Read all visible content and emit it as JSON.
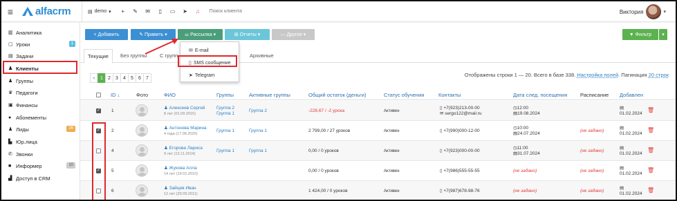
{
  "colors": {
    "accent": "#2d8ed6",
    "green": "#5bb24f",
    "red": "#e0262b",
    "teal": "#4a9e7a"
  },
  "topbar": {
    "logo": "alfacrm",
    "branch": "demo",
    "icons": [
      "plus-icon",
      "edit-icon",
      "mail-icon",
      "phone-icon",
      "sms-icon",
      "telegram-icon",
      "bell-icon"
    ],
    "search_placeholder": "Поиск клиента",
    "user_name": "Виктория"
  },
  "sidebar": {
    "items": [
      {
        "label": "Аналитика",
        "icon": "chart-icon"
      },
      {
        "label": "Уроки",
        "icon": "calendar-icon",
        "badge": "1"
      },
      {
        "label": "Задачи",
        "icon": "tasks-icon"
      },
      {
        "label": "Клиенты",
        "icon": "user-icon"
      },
      {
        "label": "Группы",
        "icon": "group-icon"
      },
      {
        "label": "Педагоги",
        "icon": "teacher-icon"
      },
      {
        "label": "Финансы",
        "icon": "money-icon"
      },
      {
        "label": "Абонементы",
        "icon": "ticket-icon"
      },
      {
        "label": "Лиды",
        "icon": "lead-icon",
        "badge": "26"
      },
      {
        "label": "Юр.лица",
        "icon": "building-icon"
      },
      {
        "label": "Звонки",
        "icon": "phone-icon"
      },
      {
        "label": "Информер",
        "icon": "informer-icon",
        "badge": "10"
      },
      {
        "label": "Доступ в CRM",
        "icon": "lock-icon"
      }
    ]
  },
  "toolbar": {
    "add": "+ Добавить",
    "edit": "✎ Править ▾",
    "mailing": "⚌ Рассылка ▾",
    "reports": "⊞ Отчеты ▾",
    "other": "— Другое ▾",
    "filter": "▼ Фильтр"
  },
  "mailing_menu": {
    "items": [
      "E-mail",
      "SMS сообщение",
      "Telegram"
    ]
  },
  "tabs": [
    "Текущие",
    "Без группы",
    "С групп",
    "Архивные"
  ],
  "pager": {
    "pages": [
      "«",
      "1",
      "2",
      "3",
      "4",
      "5",
      "6",
      "7"
    ],
    "active": "1"
  },
  "summary": {
    "text": "Отображены строки 1 — 20. Всего в базе 338.",
    "settings_link": "Настройка полей",
    "pagination_label": ". Пагинация",
    "per_page": "20 строк"
  },
  "table": {
    "headers": [
      "ID ↓",
      "Фото",
      "ФИО",
      "Группы",
      "Активные группы",
      "Общий остаток (деньги)",
      "Статус обучения",
      "Контакты",
      "Дата след. посещения",
      "Расписание",
      "Добавлен"
    ],
    "rows": [
      {
        "checked": true,
        "id": "1",
        "name": "Алексеев Сергей",
        "age": "8 лет (01.09.2015)",
        "groups": [
          "Группа 2",
          "Группа 1"
        ],
        "active": "Группа 2",
        "balance": "-228,67 / -2 урока",
        "balance_negative": true,
        "status": "Активен",
        "phone": "+7(923)213-00-00",
        "email": "sergo122@mail.ru",
        "next_time": "12:00",
        "next_date": "19.08.2024",
        "schedule": "",
        "added": "01.02.2024"
      },
      {
        "checked": true,
        "id": "2",
        "name": "Антонова Марина",
        "age": "4 года (17.08.2020)",
        "groups": [
          "Группа 1"
        ],
        "active": "Группа 1",
        "balance": "2 799,00 / 27 уроков",
        "balance_negative": false,
        "status": "Активен",
        "phone": "+7(990)000-12-00",
        "email": "",
        "next_time": "10:00",
        "next_date": "24.07.2024",
        "schedule": "(не задано)",
        "added": "01.02.2024"
      },
      {
        "checked": false,
        "id": "4",
        "name": "Егорова Лариса",
        "age": "9 лет (13.11.2014)",
        "groups": [
          "Группа 1"
        ],
        "active": "Группа 1",
        "balance": "0,00 / 0 уроков",
        "balance_negative": false,
        "status": "Активен",
        "phone": "+7(923)000-00-00",
        "email": "",
        "next_time": "11:00",
        "next_date": "31.07.2024",
        "schedule": "(не задано)",
        "added": "01.02.2024"
      },
      {
        "checked": true,
        "id": "5",
        "name": "Жукова Алла",
        "age": "14 лет (19.01.2010)",
        "groups": [],
        "active": "",
        "balance": "0,00 / 0 уроков",
        "balance_negative": false,
        "status": "Активен",
        "phone": "+7(986)555-55-55",
        "email": "",
        "next_time": "",
        "next_date": "(не задано)",
        "schedule": "(не задано)",
        "added": "01.02.2024"
      },
      {
        "checked": false,
        "id": "6",
        "name": "Зайцев Иван",
        "age": "12 лет (29.09.2011)",
        "groups": [],
        "active": "",
        "balance": "1 424,00 / 0 уроков",
        "balance_negative": false,
        "status": "Активен",
        "phone": "+7(987)678-98-76",
        "email": "",
        "next_time": "",
        "next_date": "(не задано)",
        "schedule": "(не задано)",
        "added": "01.02.2024"
      }
    ]
  }
}
